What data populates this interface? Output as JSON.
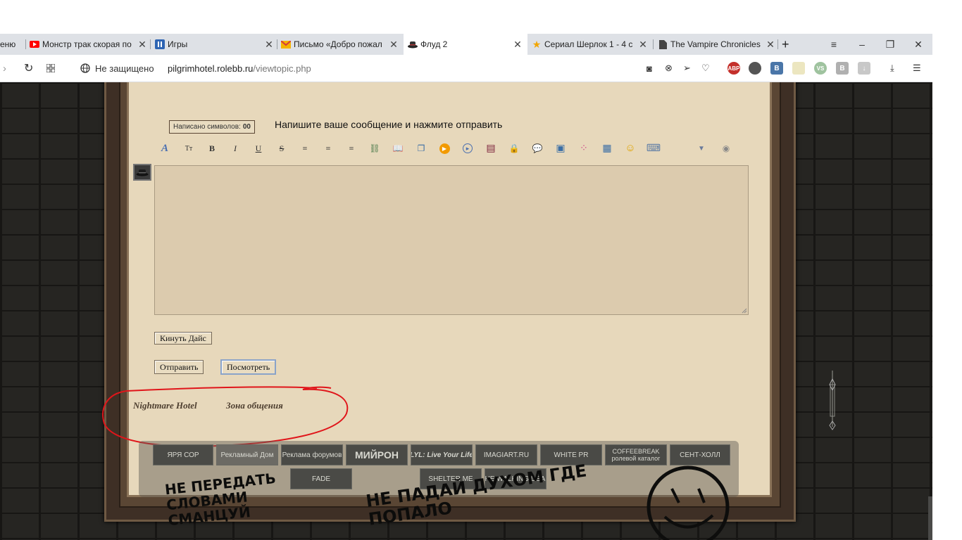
{
  "tabs": [
    {
      "label": "еню",
      "icon": "",
      "partial": true
    },
    {
      "label": "Монстр трак скорая по",
      "icon": "youtube-icon"
    },
    {
      "label": "Игры",
      "icon": "games-icon"
    },
    {
      "label": "Письмо «Добро пожал",
      "icon": "mail-icon"
    },
    {
      "label": "Флуд 2",
      "icon": "hat-icon",
      "active": true
    },
    {
      "label": "Сериал Шерлок 1 - 4 с",
      "icon": "star-icon"
    },
    {
      "label": "The Vampire Chronicles",
      "icon": "page-icon"
    }
  ],
  "new_tab_symbol": "+",
  "window": {
    "minimize": "–",
    "restore": "❐",
    "close": "✕",
    "menu": "≡"
  },
  "address": {
    "security_label": "Не защищено",
    "url_domain": "pilgrimhotel.rolebb.ru",
    "url_path": "/viewtopic.php"
  },
  "extensions": [
    {
      "icon": "adblock-icon",
      "text": "ABP",
      "color": "#c4302b"
    },
    {
      "icon": "ghost-icon",
      "text": "",
      "color": "#555555"
    },
    {
      "icon": "vk-icon",
      "text": "B",
      "color": "#4a76a8"
    },
    {
      "icon": "mail-ext-icon",
      "text": "",
      "color": "#e8e0a8"
    },
    {
      "icon": "vs-icon",
      "text": "VS",
      "color": "#9fc39f"
    },
    {
      "icon": "vk2-icon",
      "text": "B",
      "color": "#b0b0b0"
    },
    {
      "icon": "download-ext-icon",
      "text": "↓",
      "color": "#c8c8c8"
    }
  ],
  "editor": {
    "char_counter_label": "Написано символов:",
    "char_counter_value": "00",
    "hint": "Напишите ваше сообщение и нажмите отправить",
    "toolbar": [
      {
        "icon": "font-color-icon",
        "glyph": "A"
      },
      {
        "icon": "font-size-icon",
        "glyph": "Tт"
      },
      {
        "icon": "bold-icon",
        "glyph": "B"
      },
      {
        "icon": "italic-icon",
        "glyph": "I"
      },
      {
        "icon": "underline-icon",
        "glyph": "U"
      },
      {
        "icon": "strikethrough-icon",
        "glyph": "S"
      },
      {
        "icon": "align-left-icon",
        "glyph": "≡"
      },
      {
        "icon": "align-center-icon",
        "glyph": "≡"
      },
      {
        "icon": "align-right-icon",
        "glyph": "≡"
      },
      {
        "icon": "link-icon",
        "glyph": "⛓"
      },
      {
        "icon": "book-icon",
        "glyph": "📖"
      },
      {
        "icon": "copy-icon",
        "glyph": "❐"
      },
      {
        "icon": "play-icon",
        "glyph": "▶"
      },
      {
        "icon": "video-icon",
        "glyph": "▸"
      },
      {
        "icon": "books-icon",
        "glyph": "▤"
      },
      {
        "icon": "lock-icon",
        "glyph": "🔒"
      },
      {
        "icon": "speech-icon",
        "glyph": "💬"
      },
      {
        "icon": "image-icon",
        "glyph": "▣"
      },
      {
        "icon": "color-palette-icon",
        "glyph": "⁘"
      },
      {
        "icon": "table-icon",
        "glyph": "▦"
      },
      {
        "icon": "smiley-icon",
        "glyph": "☺"
      },
      {
        "icon": "keyboard-icon",
        "glyph": "⌨"
      },
      {
        "icon": "dropdown-icon",
        "glyph": "▼"
      },
      {
        "icon": "cup-icon",
        "glyph": "◉"
      }
    ],
    "dice_button": "Кинуть Дайс",
    "send_button": "Отправить",
    "preview_button": "Посмотреть"
  },
  "breadcrumbs": [
    "Nightmare Hotel",
    "Зона общения"
  ],
  "banners": [
    {
      "text": "ЯРЯ СОР"
    },
    {
      "text": "Рекламный Дом"
    },
    {
      "text": "Реклама форумов"
    },
    {
      "text": "МИЙРОН"
    },
    {
      "text": "LYL: Live Your Life"
    },
    {
      "text": "IMAGIART.RU"
    },
    {
      "text": "WHITE PR"
    },
    {
      "text": "COFFEEBREAK ролевой каталог"
    },
    {
      "text": "СЕНТ-ХОЛЛ"
    },
    {
      "text": "FADE"
    },
    {
      "text": "SHELTER ME"
    },
    {
      "text": "THE WALKING DEAD"
    }
  ],
  "wall_text": [
    "НЕ ПЕРЕДАТЬ СЛОВАМИ СМАНЦУЙ",
    "НЕ ПАДАЙ ДУХОМ ГДЕ ПОПАЛО"
  ]
}
